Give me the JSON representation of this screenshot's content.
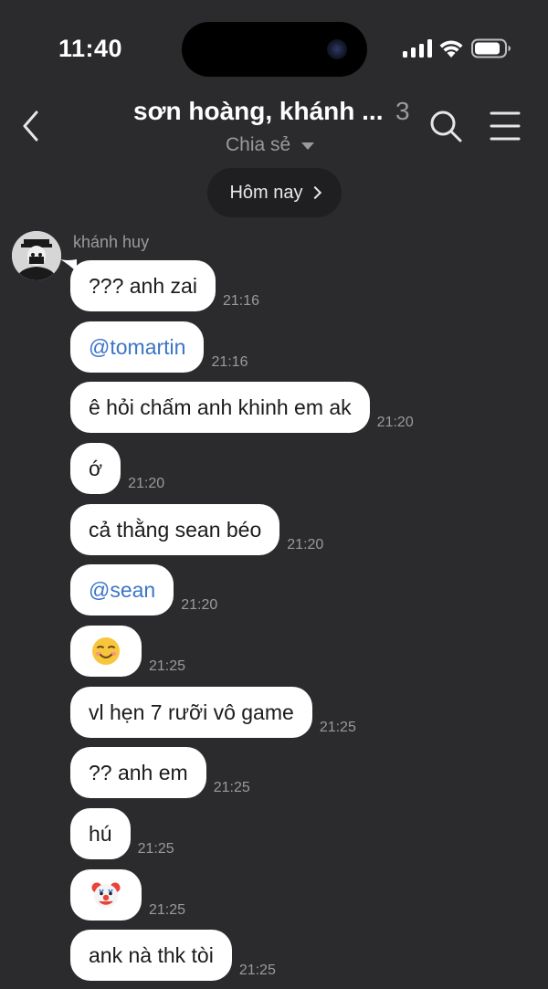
{
  "status_bar": {
    "time": "11:40"
  },
  "header": {
    "title": "sơn hoàng, khánh ...",
    "member_count": "3",
    "subtitle": "Chia sẻ"
  },
  "date_pill": {
    "label": "Hôm nay"
  },
  "sender": {
    "name": "khánh huy"
  },
  "messages": [
    {
      "text": "??? anh zai",
      "time": "21:16",
      "kind": "text"
    },
    {
      "text": "@tomartin",
      "time": "21:16",
      "kind": "mention"
    },
    {
      "text": "ê hỏi chấm anh khinh em ak",
      "time": "21:20",
      "kind": "text"
    },
    {
      "text": "ớ",
      "time": "21:20",
      "kind": "text"
    },
    {
      "text": "cả thằng sean béo",
      "time": "21:20",
      "kind": "text"
    },
    {
      "text": "@sean",
      "time": "21:20",
      "kind": "mention"
    },
    {
      "text": "",
      "time": "21:25",
      "kind": "emoji",
      "icon": "smiling-face-icon"
    },
    {
      "text": "vl hẹn 7 rưỡi vô game",
      "time": "21:25",
      "kind": "text"
    },
    {
      "text": "?? anh em",
      "time": "21:25",
      "kind": "text"
    },
    {
      "text": "hú",
      "time": "21:25",
      "kind": "text"
    },
    {
      "text": "",
      "time": "21:25",
      "kind": "emoji",
      "icon": "clown-face-icon"
    },
    {
      "text": "ank nà thk tòi",
      "time": "21:25",
      "kind": "text"
    }
  ]
}
